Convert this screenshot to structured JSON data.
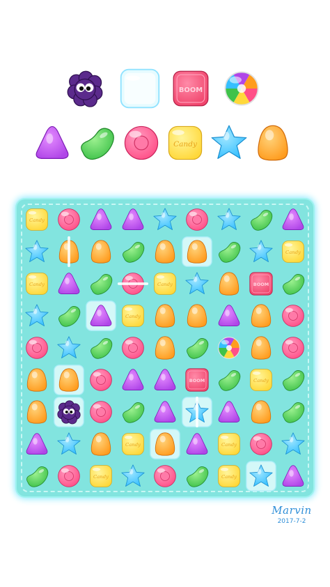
{
  "colors": {
    "board": "#82e4df",
    "board_glow": "#83e8ff",
    "purple": "#b046e8",
    "green": "#3fc24a",
    "pink": "#ff4f87",
    "yellow": "#ffd83a",
    "blue": "#35bfff",
    "orange": "#ff9c1e",
    "boom_box": "#f0456c"
  },
  "legend": {
    "row1": [
      {
        "name": "blocker-berry-icon",
        "kind": "berry"
      },
      {
        "name": "ice-block-icon",
        "kind": "ice"
      },
      {
        "name": "boom-box-icon",
        "kind": "boom"
      },
      {
        "name": "rainbow-candy-icon",
        "kind": "rainbow"
      }
    ],
    "row2": [
      {
        "name": "purple-triangle-candy-icon",
        "kind": "triangle"
      },
      {
        "name": "green-bean-candy-icon",
        "kind": "bean"
      },
      {
        "name": "pink-round-candy-icon",
        "kind": "round"
      },
      {
        "name": "yellow-square-candy-icon",
        "kind": "square"
      },
      {
        "name": "blue-star-candy-icon",
        "kind": "star"
      },
      {
        "name": "orange-drop-candy-icon",
        "kind": "drop"
      }
    ]
  },
  "candy_labels": {
    "square": "Candy",
    "boom": "BOOM"
  },
  "board": {
    "rows": [
      [
        "Y",
        "R",
        "P",
        "P",
        "B",
        "R",
        "B",
        "G",
        "P"
      ],
      [
        "B",
        "O",
        "O",
        "G",
        "O",
        "O",
        "G",
        "B",
        "Y"
      ],
      [
        "Y",
        "P",
        "G",
        "R",
        "Y",
        "B",
        "O",
        "X",
        "G"
      ],
      [
        "B",
        "G",
        "P",
        "Y",
        "O",
        "O",
        "P",
        "O",
        "R"
      ],
      [
        "R",
        "B",
        "G",
        "R",
        "O",
        "G",
        "W",
        "O",
        "R"
      ],
      [
        "O",
        "O",
        "R",
        "P",
        "P",
        "X",
        "G",
        "Y",
        "G"
      ],
      [
        "O",
        "K",
        "R",
        "G",
        "P",
        "B",
        "P",
        "O",
        "G"
      ],
      [
        "P",
        "B",
        "O",
        "Y",
        "O",
        "P",
        "Y",
        "R",
        "B"
      ],
      [
        "G",
        "R",
        "Y",
        "B",
        "R",
        "G",
        "Y",
        "B",
        "P"
      ]
    ],
    "ice_cells": [
      "1-5",
      "3-2",
      "5-1",
      "6-1",
      "6-5",
      "7-4",
      "8-7"
    ],
    "special_cells": {
      "1-1": "vertical-stripe",
      "2-3": "horizontal-stripe",
      "6-5": "vertical-stripe"
    }
  },
  "signature": {
    "name": "Marvin",
    "date": "2017-7-2"
  }
}
